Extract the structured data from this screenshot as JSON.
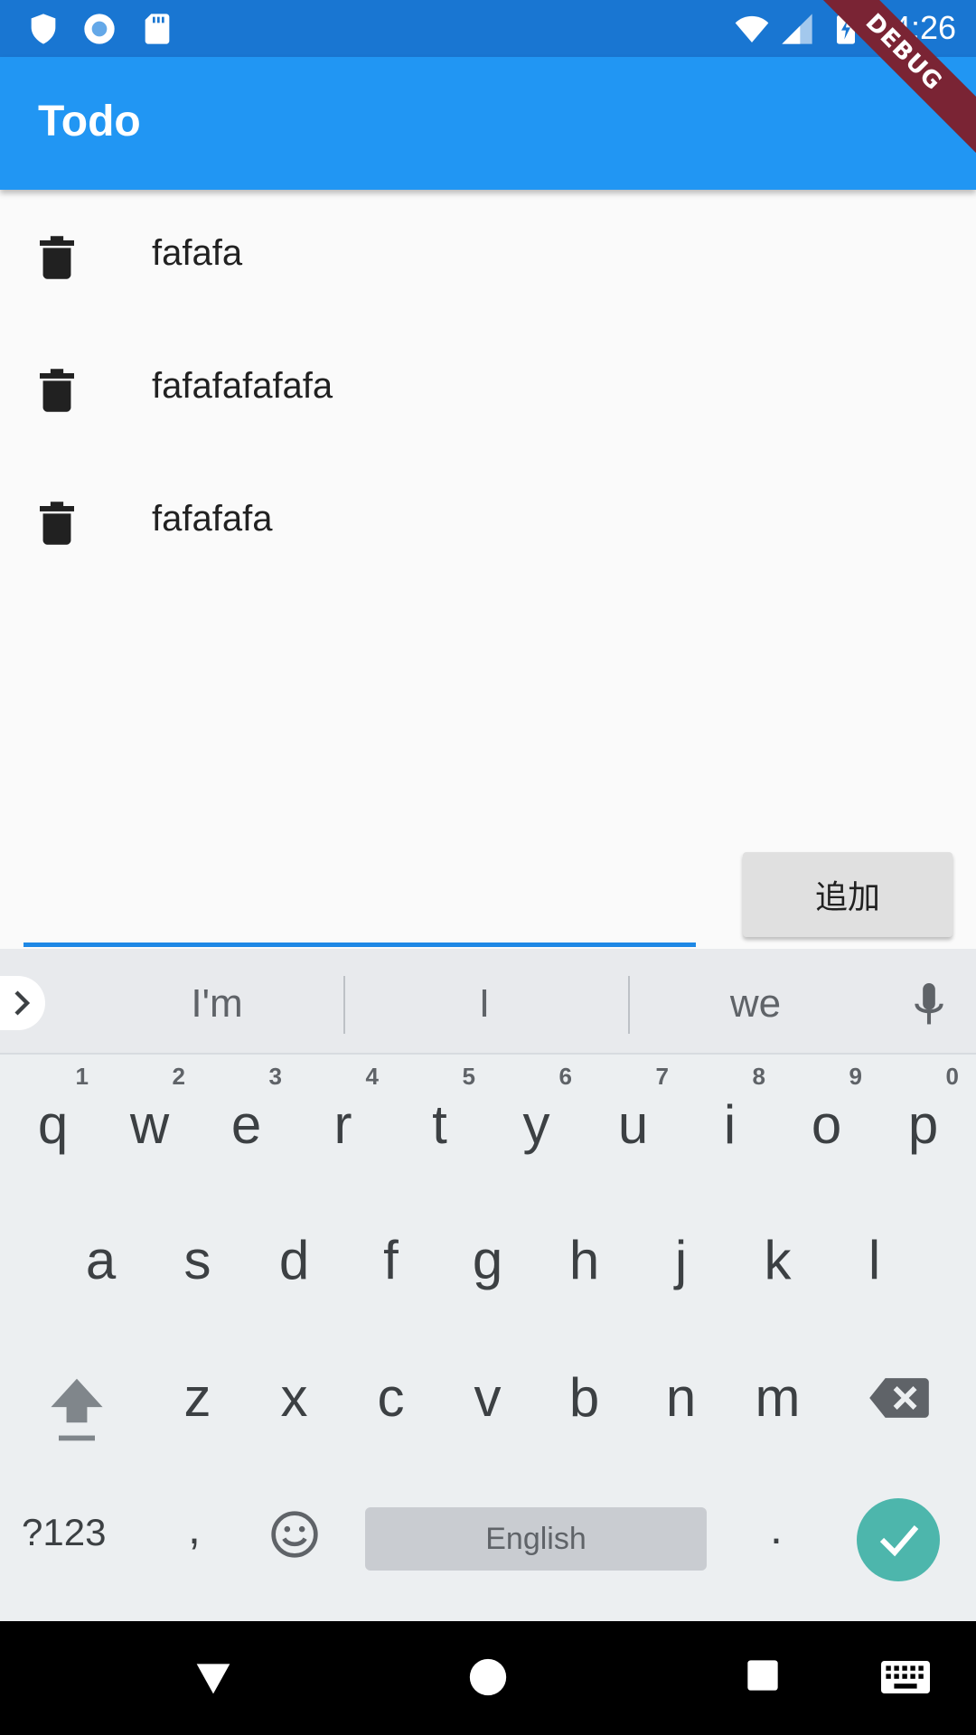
{
  "status_bar": {
    "time": "14:26",
    "left_icons": [
      "shield-icon",
      "record-icon",
      "sd-card-icon"
    ],
    "right_icons": [
      "wifi-icon",
      "signal-icon",
      "battery-charging-icon"
    ]
  },
  "debug_banner": "DEBUG",
  "app_bar": {
    "title": "Todo"
  },
  "todos": [
    {
      "text": "fafafa",
      "icon": "delete-icon"
    },
    {
      "text": "fafafafafafa",
      "icon": "delete-icon"
    },
    {
      "text": "fafafafa",
      "icon": "delete-icon"
    }
  ],
  "input": {
    "value": "",
    "placeholder": ""
  },
  "add_button": {
    "label": "追加"
  },
  "keyboard": {
    "suggestions": [
      "I'm",
      "I",
      "we"
    ],
    "row1": [
      {
        "key": "q",
        "hint": "1"
      },
      {
        "key": "w",
        "hint": "2"
      },
      {
        "key": "e",
        "hint": "3"
      },
      {
        "key": "r",
        "hint": "4"
      },
      {
        "key": "t",
        "hint": "5"
      },
      {
        "key": "y",
        "hint": "6"
      },
      {
        "key": "u",
        "hint": "7"
      },
      {
        "key": "i",
        "hint": "8"
      },
      {
        "key": "o",
        "hint": "9"
      },
      {
        "key": "p",
        "hint": "0"
      }
    ],
    "row2": [
      "a",
      "s",
      "d",
      "f",
      "g",
      "h",
      "j",
      "k",
      "l"
    ],
    "row3": [
      "z",
      "x",
      "c",
      "v",
      "b",
      "n",
      "m"
    ],
    "symbols_label": "?123",
    "comma": ",",
    "space_label": "English",
    "period": ".",
    "accent_color": "#4db6ac"
  },
  "colors": {
    "primary": "#2196f3",
    "status_bar": "#1976d2",
    "underline": "#1e88e5"
  }
}
